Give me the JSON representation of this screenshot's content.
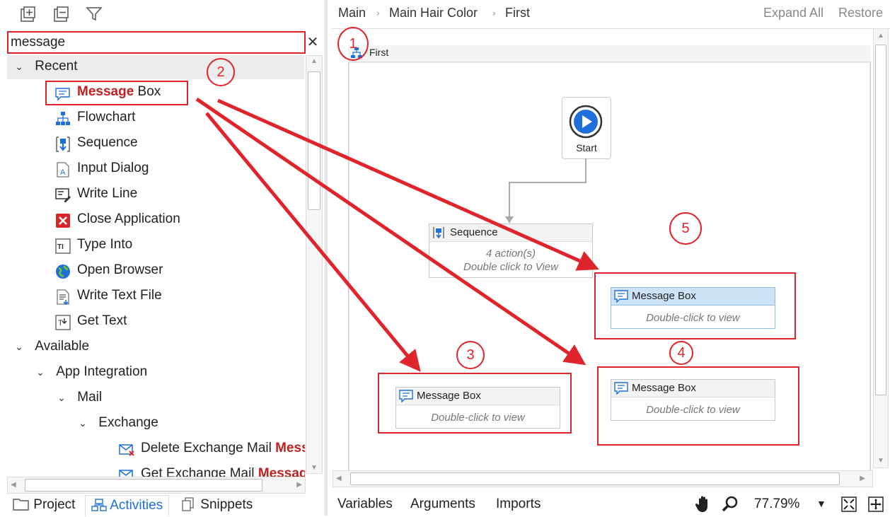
{
  "toolbar": {
    "expand_icon": "expand-all-icon",
    "collapse_icon": "collapse-all-icon",
    "filter_icon": "filter-icon"
  },
  "search": {
    "value": "message",
    "clear": "✕"
  },
  "tree": {
    "recent_label": "Recent",
    "recent_items": [
      {
        "hl": "Message",
        "rest": " Box",
        "icon": "message-box-icon"
      },
      {
        "hl": "",
        "rest": "Flowchart",
        "icon": "flowchart-icon"
      },
      {
        "hl": "",
        "rest": "Sequence",
        "icon": "sequence-icon"
      },
      {
        "hl": "",
        "rest": "Input Dialog",
        "icon": "input-dialog-icon"
      },
      {
        "hl": "",
        "rest": "Write Line",
        "icon": "write-line-icon"
      },
      {
        "hl": "",
        "rest": "Close Application",
        "icon": "close-application-icon"
      },
      {
        "hl": "",
        "rest": "Type Into",
        "icon": "type-into-icon"
      },
      {
        "hl": "",
        "rest": "Open Browser",
        "icon": "open-browser-icon"
      },
      {
        "hl": "",
        "rest": "Write Text File",
        "icon": "write-text-file-icon"
      },
      {
        "hl": "",
        "rest": "Get Text",
        "icon": "get-text-icon"
      }
    ],
    "available_label": "Available",
    "app_integration_label": "App Integration",
    "mail_label": "Mail",
    "exchange_label": "Exchange",
    "exchange_items": [
      {
        "text": "Delete Exchange Mail ",
        "hl": "Mess"
      },
      {
        "text": "Get Exchange Mail ",
        "hl": "Messag"
      }
    ]
  },
  "bottom_tabs": {
    "project": "Project",
    "activities": "Activities",
    "snippets": "Snippets"
  },
  "breadcrumb": {
    "items": [
      "Main",
      "Main Hair Color",
      "First"
    ],
    "sep": "›"
  },
  "top_actions": {
    "expand_all": "Expand All",
    "restore": "Restore"
  },
  "canvas": {
    "title": "First",
    "start_label": "Start",
    "sequence": {
      "title": "Sequence",
      "line1": "4 action(s)",
      "line2": "Double click to View"
    },
    "message_boxes": [
      {
        "title": "Message Box",
        "body": "Double-click to view"
      },
      {
        "title": "Message Box",
        "body": "Double-click to view"
      },
      {
        "title": "Message Box",
        "body": "Double-click to view"
      }
    ]
  },
  "annotations": {
    "n1": "1",
    "n2": "2",
    "n3": "3",
    "n4": "4",
    "n5": "5",
    "color": "#e0242b"
  },
  "bottom_bar": {
    "variables": "Variables",
    "arguments": "Arguments",
    "imports": "Imports",
    "zoom": "77.79%"
  },
  "colors": {
    "accent": "#1e6fd9",
    "highlight": "#c02020",
    "selected_activity_head": "#cde3f7"
  }
}
